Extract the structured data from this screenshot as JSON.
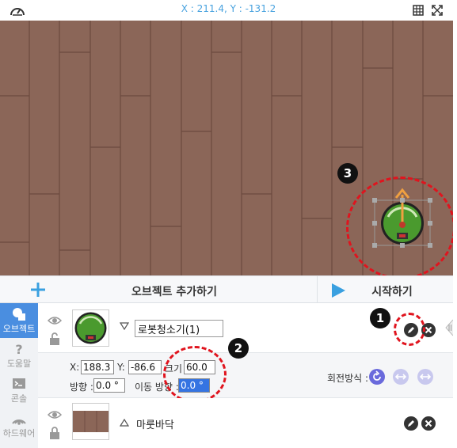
{
  "topbar": {
    "coordinates": "X : 211.4, Y : -131.2"
  },
  "icons": {
    "speed": "speedometer-icon",
    "grid": "grid-icon",
    "fullscreen": "fullscreen-icon",
    "add": "plus-icon",
    "play": "play-icon",
    "eye": "eye-icon",
    "lock": "lock-icon",
    "edit": "pencil-icon",
    "delete": "close-icon"
  },
  "toolbar": {
    "add_object_label": "오브젝트 추가하기",
    "start_label": "시작하기"
  },
  "sidetabs": [
    {
      "label": "오브젝트",
      "active": true
    },
    {
      "label": "도움말",
      "active": false
    },
    {
      "label": "콘솔",
      "active": false
    },
    {
      "label": "하드웨어",
      "active": false
    }
  ],
  "objects": [
    {
      "name": "로봇청소기(1)",
      "x_label": "X:",
      "x_value": "188.3",
      "y_label": "Y:",
      "y_value": "-86.6",
      "size_label": "크기 :",
      "size_value": "60.0",
      "direction_label": "방향 :",
      "direction_value": "0.0 °",
      "move_direction_label": "이동 방향 :",
      "move_direction_value": "0.0 °",
      "rotation_label": "회전방식 :"
    },
    {
      "name": "마룻바닥"
    }
  ],
  "annotations": [
    "1",
    "2",
    "3"
  ],
  "colors": {
    "accent_blue": "#4a8ee0",
    "coord_blue": "#4aa3df",
    "highlight_red": "#e0141e",
    "floor_brown": "#8b6658",
    "robot_green": "#4a9a2e",
    "arrow_orange": "#f0a040",
    "rotation_purple": "#6a6adc"
  }
}
